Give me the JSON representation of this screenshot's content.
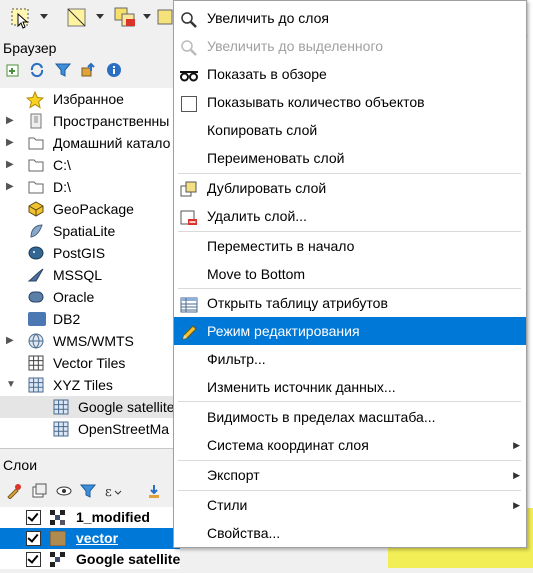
{
  "toolbar": {
    "buttons": [
      "select-features-icon",
      "select-by-area-icon",
      "deselect-icon",
      "identify-icon"
    ]
  },
  "browser": {
    "title": "Браузер",
    "tools": [
      "add-layer-icon",
      "refresh-icon",
      "filter-icon",
      "collapse-icon",
      "info-icon"
    ],
    "items": [
      {
        "label": "Избранное",
        "icon": "star-icon",
        "expand": ""
      },
      {
        "label": "Пространственны",
        "icon": "bookmark-icon",
        "expand": "▶"
      },
      {
        "label": "Домашний катало",
        "icon": "folder-icon",
        "expand": "▶"
      },
      {
        "label": "C:\\",
        "icon": "folder-icon",
        "expand": "▶"
      },
      {
        "label": "D:\\",
        "icon": "folder-icon",
        "expand": "▶"
      },
      {
        "label": "GeoPackage",
        "icon": "geopackage-icon",
        "expand": ""
      },
      {
        "label": "SpatiaLite",
        "icon": "spatialite-icon",
        "expand": ""
      },
      {
        "label": "PostGIS",
        "icon": "postgis-icon",
        "expand": ""
      },
      {
        "label": "MSSQL",
        "icon": "mssql-icon",
        "expand": ""
      },
      {
        "label": "Oracle",
        "icon": "oracle-icon",
        "expand": ""
      },
      {
        "label": "DB2",
        "icon": "db2-icon",
        "expand": ""
      },
      {
        "label": "WMS/WMTS",
        "icon": "globe-icon",
        "expand": "▶"
      },
      {
        "label": "Vector Tiles",
        "icon": "grid-icon",
        "expand": ""
      },
      {
        "label": "XYZ Tiles",
        "icon": "grid-icon",
        "expand": "▼"
      },
      {
        "label": "Google satellite",
        "icon": "grid-icon",
        "expand": ""
      },
      {
        "label": "OpenStreetMa",
        "icon": "grid-icon",
        "expand": ""
      }
    ]
  },
  "layers": {
    "title": "Слои",
    "tools": [
      "style-icon",
      "add-group-icon",
      "visibility-icon",
      "filter-icon",
      "expression-icon",
      "expand-icon"
    ],
    "items": [
      {
        "label": "1_modified",
        "selected": false
      },
      {
        "label": "vector",
        "selected": true
      },
      {
        "label": "Google satellite",
        "selected": false
      }
    ]
  },
  "menu": {
    "items": [
      {
        "label": "Увеличить до слоя",
        "icon": "zoom-layer-icon",
        "disabled": false,
        "submenu": false
      },
      {
        "label": "Увеличить до выделенного",
        "icon": "zoom-selection-icon",
        "disabled": true,
        "submenu": false
      },
      {
        "label": "Показать в обзоре",
        "icon": "glasses-icon",
        "disabled": false,
        "submenu": false
      },
      {
        "label": "Показывать количество объектов",
        "icon": "checkbox-icon",
        "disabled": false,
        "submenu": false
      },
      {
        "label": "Копировать слой",
        "icon": "",
        "disabled": false,
        "submenu": false
      },
      {
        "label": "Переименовать слой",
        "icon": "",
        "disabled": false,
        "submenu": false
      },
      {
        "label": "Дублировать слой",
        "icon": "duplicate-icon",
        "disabled": false,
        "submenu": false
      },
      {
        "label": "Удалить слой...",
        "icon": "remove-layer-icon",
        "disabled": false,
        "submenu": false
      },
      {
        "label": "Переместить в начало",
        "icon": "",
        "disabled": false,
        "submenu": false
      },
      {
        "label": "Move to Bottom",
        "icon": "",
        "disabled": false,
        "submenu": false
      },
      {
        "label": "Открыть таблицу атрибутов",
        "icon": "table-icon",
        "disabled": false,
        "submenu": false
      },
      {
        "label": "Режим редактирования",
        "icon": "pencil-icon",
        "disabled": false,
        "submenu": false,
        "selected": true
      },
      {
        "label": "Фильтр...",
        "icon": "",
        "disabled": false,
        "submenu": false
      },
      {
        "label": "Изменить источник данных...",
        "icon": "",
        "disabled": false,
        "submenu": false
      },
      {
        "label": "Видимость в пределах масштаба...",
        "icon": "",
        "disabled": false,
        "submenu": false
      },
      {
        "label": "Система координат слоя",
        "icon": "",
        "disabled": false,
        "submenu": true
      },
      {
        "label": "Экспорт",
        "icon": "",
        "disabled": false,
        "submenu": true
      },
      {
        "label": "Стили",
        "icon": "",
        "disabled": false,
        "submenu": true
      },
      {
        "label": "Свойства...",
        "icon": "",
        "disabled": false,
        "submenu": false
      }
    ],
    "submenu_arrow": "▶"
  },
  "colors": {
    "selection": "#0078d7",
    "menu_border": "#a0a0a0",
    "map_yellow": "#f2ee55"
  }
}
